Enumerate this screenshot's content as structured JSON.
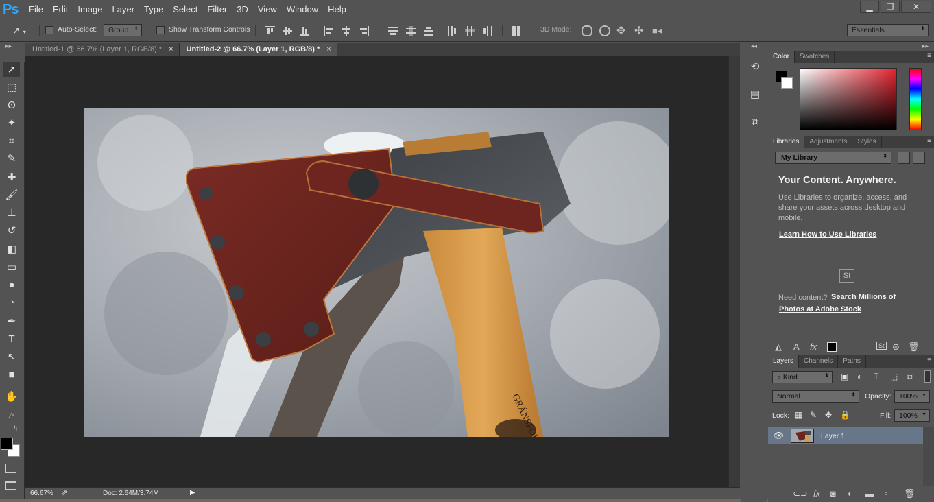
{
  "app": {
    "logo": "Ps"
  },
  "menu": [
    "File",
    "Edit",
    "Image",
    "Layer",
    "Type",
    "Select",
    "Filter",
    "3D",
    "View",
    "Window",
    "Help"
  ],
  "window_controls": {
    "minimize": "▁",
    "restore": "❐",
    "close": "✕"
  },
  "options": {
    "auto_select_label": "Auto-Select:",
    "auto_select_value": "Group",
    "show_transform_label": "Show Transform Controls",
    "mode_3d_label": "3D Mode:",
    "workspace": "Essentials"
  },
  "tabs": [
    {
      "label": "Untitled-1 @ 66.7% (Layer 1, RGB/8) *",
      "close": "×",
      "active": false
    },
    {
      "label": "Untitled-2 @ 66.7% (Layer 1, RGB/8) *",
      "close": "×",
      "active": true
    }
  ],
  "status": {
    "zoom": "66.67%",
    "doc": "Doc: 2.64M/3.74M"
  },
  "tools": [
    {
      "name": "move-tool",
      "glyph": "➚"
    },
    {
      "name": "marquee-tool",
      "glyph": "⬚"
    },
    {
      "name": "lasso-tool",
      "glyph": "ʘ"
    },
    {
      "name": "quick-select-tool",
      "glyph": "✦"
    },
    {
      "name": "crop-tool",
      "glyph": "⌗"
    },
    {
      "name": "eyedropper-tool",
      "glyph": "✎"
    },
    {
      "name": "healing-brush-tool",
      "glyph": "✚"
    },
    {
      "name": "brush-tool",
      "glyph": "🖌"
    },
    {
      "name": "clone-stamp-tool",
      "glyph": "⊥"
    },
    {
      "name": "history-brush-tool",
      "glyph": "↺"
    },
    {
      "name": "eraser-tool",
      "glyph": "◧"
    },
    {
      "name": "gradient-tool",
      "glyph": "▭"
    },
    {
      "name": "blur-tool",
      "glyph": "●"
    },
    {
      "name": "dodge-tool",
      "glyph": "◔"
    },
    {
      "name": "pen-tool",
      "glyph": "✒"
    },
    {
      "name": "type-tool",
      "glyph": "T"
    },
    {
      "name": "path-select-tool",
      "glyph": "↖"
    },
    {
      "name": "rectangle-tool",
      "glyph": "■"
    },
    {
      "name": "hand-tool",
      "glyph": "✋"
    },
    {
      "name": "zoom-tool",
      "glyph": "⌕"
    }
  ],
  "color_panel": {
    "tabs": [
      "Color",
      "Swatches"
    ],
    "accent_hue": "#e8232f"
  },
  "libraries_panel": {
    "tabs": [
      "Libraries",
      "Adjustments",
      "Styles"
    ],
    "library": "My Library",
    "title": "Your Content. Anywhere.",
    "description": "Use Libraries to organize, access, and share your assets across desktop and mobile.",
    "learn_link": "Learn How to Use Libraries",
    "stock_badge": "St",
    "need_content": "Need content?",
    "search_link_1": "Search Millions of",
    "search_link_2": "Photos at Adobe Stock"
  },
  "layers_panel": {
    "tabs": [
      "Layers",
      "Channels",
      "Paths"
    ],
    "kind": "Kind",
    "blend_mode": "Normal",
    "opacity_label": "Opacity:",
    "opacity": "100%",
    "lock_label": "Lock:",
    "fill_label": "Fill:",
    "fill": "100%",
    "layers": [
      {
        "name": "Layer 1",
        "selected": true
      }
    ]
  }
}
